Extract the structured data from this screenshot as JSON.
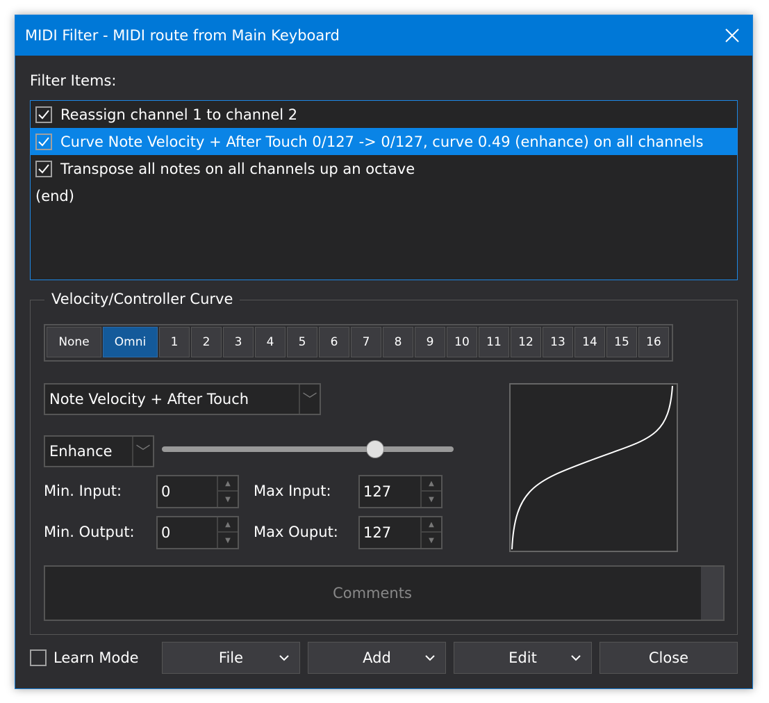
{
  "window": {
    "title": "MIDI Filter - MIDI route from Main Keyboard",
    "accent": "#0078d7"
  },
  "filter_items": {
    "label": "Filter Items:",
    "items": [
      {
        "text": "Reassign channel 1 to channel 2",
        "checked": true,
        "selected": false
      },
      {
        "text": "Curve Note Velocity + After Touch 0/127 -> 0/127, curve 0.49 (enhance) on all channels",
        "checked": true,
        "selected": true
      },
      {
        "text": "Transpose all notes on all channels up an octave",
        "checked": true,
        "selected": false
      }
    ],
    "end_label": "(end)"
  },
  "curve_group": {
    "legend": "Velocity/Controller Curve",
    "channels": [
      "None",
      "Omni",
      "1",
      "2",
      "3",
      "4",
      "5",
      "6",
      "7",
      "8",
      "9",
      "10",
      "11",
      "12",
      "13",
      "14",
      "15",
      "16"
    ],
    "selected_channel": "Omni",
    "controller": "Note Velocity + After Touch",
    "curve_type": "Enhance",
    "slider_position": 0.73,
    "min_input_label": "Min. Input:",
    "min_input": "0",
    "max_input_label": "Max Input:",
    "max_input": "127",
    "min_output_label": "Min. Output:",
    "min_output": "0",
    "max_output_label": "Max Ouput:",
    "max_output": "127",
    "comments_placeholder": "Comments"
  },
  "footer": {
    "learn_mode": "Learn Mode",
    "learn_checked": false,
    "file": "File",
    "add": "Add",
    "edit": "Edit",
    "close": "Close"
  }
}
